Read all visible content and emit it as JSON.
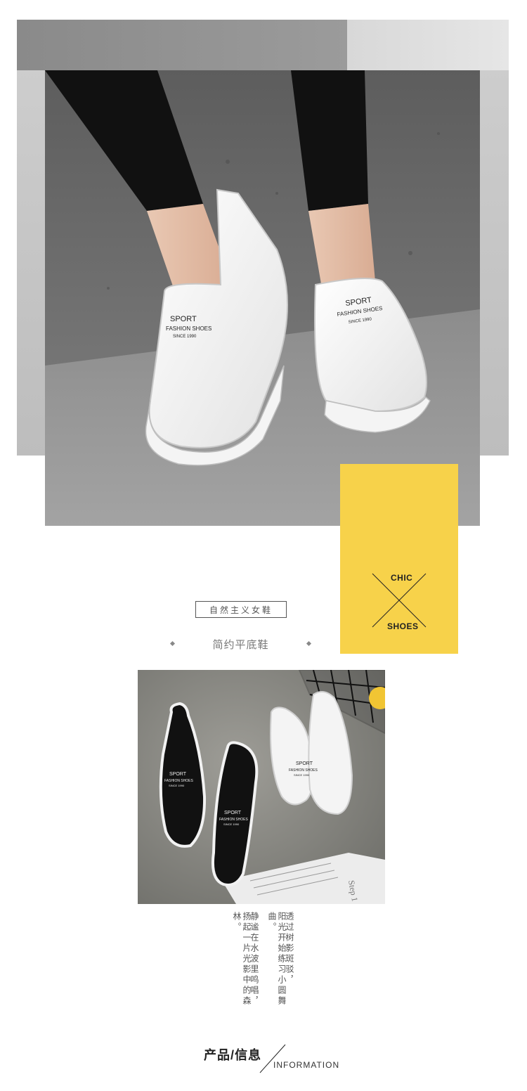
{
  "hero": {
    "shoe_text": {
      "line1": "SPORT",
      "line2": "FASHION SHOES",
      "line3": "SINCE 1990"
    }
  },
  "tag": {
    "top": "CHIC",
    "bottom": "SHOES",
    "color": "#f7d24a"
  },
  "badge": {
    "label": "自然主义女鞋"
  },
  "subtitle": {
    "label": "简约平底鞋"
  },
  "photo2": {
    "shoe_text": {
      "line1": "SPORT",
      "line2": "FASHION SHOES",
      "line3": "SINCE 1990"
    },
    "magazine_word": "Step 1"
  },
  "poem": {
    "line1": "透过树影斑驳，",
    "line2": "阳光开始练习小圆舞曲。",
    "line3": "静谧在水波里鸣唱，",
    "line4": "扬起一片光影中的森林。"
  },
  "footer": {
    "title": "产品/信息",
    "subtitle": "INFORMATION"
  }
}
